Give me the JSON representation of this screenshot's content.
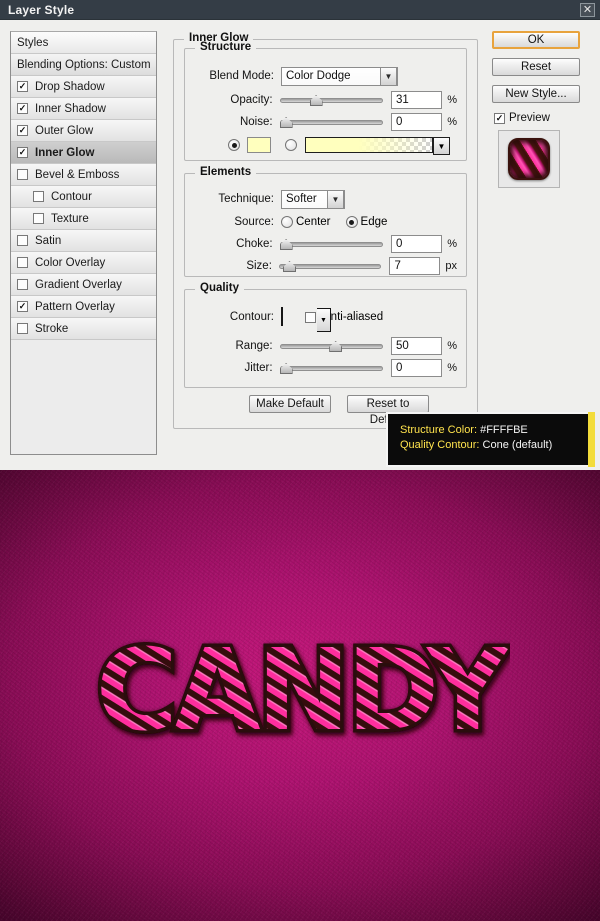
{
  "window": {
    "title": "Layer Style",
    "close_icon": "close-icon"
  },
  "styles_panel": {
    "header": "Styles",
    "blending_options": "Blending Options: Custom",
    "items": [
      {
        "label": "Drop Shadow",
        "checked": true,
        "sub": false,
        "selected": false
      },
      {
        "label": "Inner Shadow",
        "checked": true,
        "sub": false,
        "selected": false
      },
      {
        "label": "Outer Glow",
        "checked": true,
        "sub": false,
        "selected": false
      },
      {
        "label": "Inner Glow",
        "checked": true,
        "sub": false,
        "selected": true
      },
      {
        "label": "Bevel & Emboss",
        "checked": false,
        "sub": false,
        "selected": false
      },
      {
        "label": "Contour",
        "checked": false,
        "sub": true,
        "selected": false
      },
      {
        "label": "Texture",
        "checked": false,
        "sub": true,
        "selected": false
      },
      {
        "label": "Satin",
        "checked": false,
        "sub": false,
        "selected": false
      },
      {
        "label": "Color Overlay",
        "checked": false,
        "sub": false,
        "selected": false
      },
      {
        "label": "Gradient Overlay",
        "checked": false,
        "sub": false,
        "selected": false
      },
      {
        "label": "Pattern Overlay",
        "checked": true,
        "sub": false,
        "selected": false
      },
      {
        "label": "Stroke",
        "checked": false,
        "sub": false,
        "selected": false
      }
    ]
  },
  "glow_panel": {
    "title": "Inner Glow",
    "structure": {
      "legend": "Structure",
      "blend_mode_label": "Blend Mode:",
      "blend_mode_value": "Color Dodge",
      "opacity_label": "Opacity:",
      "opacity_value": "31",
      "opacity_unit": "%",
      "noise_label": "Noise:",
      "noise_value": "0",
      "noise_unit": "%",
      "color_mode": "solid",
      "color_hex": "#FFFFBE",
      "gradient_from": "#FFFFBE",
      "gradient_to": "transparent"
    },
    "elements": {
      "legend": "Elements",
      "technique_label": "Technique:",
      "technique_value": "Softer",
      "source_label": "Source:",
      "source_center": "Center",
      "source_edge": "Edge",
      "source_selected": "Edge",
      "choke_label": "Choke:",
      "choke_value": "0",
      "choke_unit": "%",
      "size_label": "Size:",
      "size_value": "7",
      "size_unit": "px"
    },
    "quality": {
      "legend": "Quality",
      "contour_label": "Contour:",
      "contour_name": "Cone (default)",
      "antialiased_label": "Anti-aliased",
      "antialiased_checked": false,
      "range_label": "Range:",
      "range_value": "50",
      "range_unit": "%",
      "jitter_label": "Jitter:",
      "jitter_value": "0",
      "jitter_unit": "%"
    },
    "make_default": "Make Default",
    "reset_to_default": "Reset to Default"
  },
  "buttons": {
    "ok": "OK",
    "reset": "Reset",
    "new_style": "New Style...",
    "preview_label": "Preview",
    "preview_checked": true
  },
  "tooltip": {
    "line1_key": "Structure Color:",
    "line1_value": "#FFFFBE",
    "line2_key": "Quality Contour:",
    "line2_value": "Cone (default)",
    "accent_color": "#F3DC3A"
  },
  "canvas": {
    "artwork_text": "CANDY",
    "background_center": "#C7187C",
    "background_edge": "#46052B",
    "stripe_light": "#FF3AA6",
    "stripe_dark": "#3A100C"
  }
}
